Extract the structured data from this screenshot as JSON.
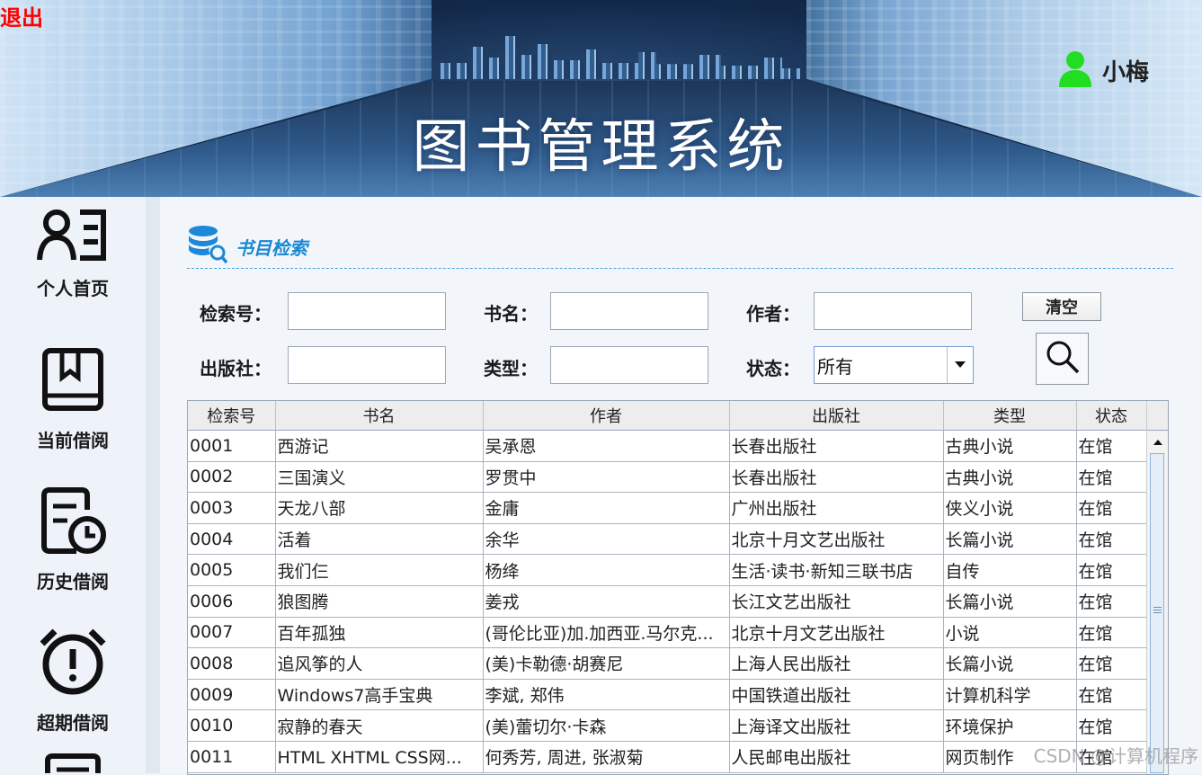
{
  "header": {
    "logout_label": "退出",
    "title": "图书管理系统",
    "user_name": "小梅"
  },
  "sidebar": {
    "items": [
      {
        "label": "个人首页",
        "icon": "person-list-icon"
      },
      {
        "label": "当前借阅",
        "icon": "book-icon"
      },
      {
        "label": "历史借阅",
        "icon": "document-clock-icon"
      },
      {
        "label": "超期借阅",
        "icon": "alarm-clock-icon"
      }
    ]
  },
  "search": {
    "section_title": "书目检索",
    "section_icon": "database-search-icon",
    "index_label": "检索号：",
    "title_label": "书名：",
    "author_label": "作者：",
    "publisher_label": "出版社：",
    "type_label": "类型：",
    "status_label": "状态：",
    "index_value": "",
    "title_value": "",
    "author_value": "",
    "publisher_value": "",
    "type_value": "",
    "status_value": "所有",
    "clear_label": "清空"
  },
  "table": {
    "columns": [
      "检索号",
      "书名",
      "作者",
      "出版社",
      "类型",
      "状态"
    ],
    "rows": [
      [
        "0001",
        "西游记",
        "吴承恩",
        "长春出版社",
        "古典小说",
        "在馆"
      ],
      [
        "0002",
        "三国演义",
        "罗贯中",
        "长春出版社",
        "古典小说",
        "在馆"
      ],
      [
        "0003",
        "天龙八部",
        "金庸",
        "广州出版社",
        "侠义小说",
        "在馆"
      ],
      [
        "0004",
        "活着",
        "余华",
        "北京十月文艺出版社",
        "长篇小说",
        "在馆"
      ],
      [
        "0005",
        "我们仨",
        "杨绛",
        "生活·读书·新知三联书店",
        "自传",
        "在馆"
      ],
      [
        "0006",
        "狼图腾",
        "姜戎",
        "长江文艺出版社",
        "长篇小说",
        "在馆"
      ],
      [
        "0007",
        "百年孤独",
        "(哥伦比亚)加.加西亚.马尔克...",
        "北京十月文艺出版社",
        "小说",
        "在馆"
      ],
      [
        "0008",
        "追风筝的人",
        "(美)卡勒德·胡赛尼",
        "上海人民出版社",
        "长篇小说",
        "在馆"
      ],
      [
        "0009",
        "Windows7高手宝典",
        "李斌, 郑伟",
        "中国铁道出版社",
        "计算机科学",
        "在馆"
      ],
      [
        "0010",
        "寂静的春天",
        "(美)蕾切尔·卡森",
        "上海译文出版社",
        "环境保护",
        "在馆"
      ],
      [
        "0011",
        "HTML XHTML CSS网...",
        "何秀芳, 周进, 张淑菊",
        "人民邮电出版社",
        "网页制作",
        "在馆"
      ]
    ]
  },
  "watermark": "CSDN @计算机程序",
  "colors": {
    "logout": "#ff0000",
    "section_title": "#1a87d0",
    "user_icon": "#22dd22"
  }
}
